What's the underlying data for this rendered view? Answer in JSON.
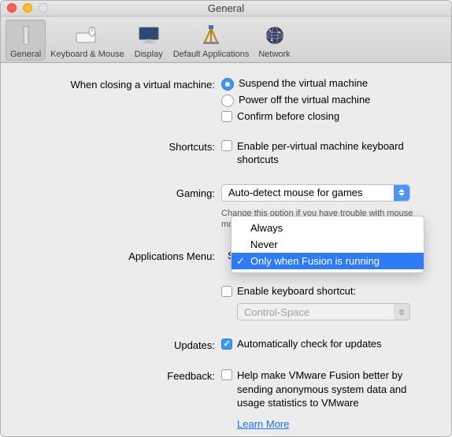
{
  "window": {
    "title": "General"
  },
  "toolbar": {
    "items": [
      {
        "label": "General"
      },
      {
        "label": "Keyboard & Mouse"
      },
      {
        "label": "Display"
      },
      {
        "label": "Default Applications"
      },
      {
        "label": "Network"
      }
    ]
  },
  "closing": {
    "label": "When closing a virtual machine:",
    "opt_suspend": "Suspend the virtual machine",
    "opt_poweroff": "Power off the virtual machine",
    "opt_confirm": "Confirm before closing"
  },
  "shortcuts": {
    "label": "Shortcuts:",
    "enable": "Enable per-virtual machine keyboard shortcuts"
  },
  "gaming": {
    "label": "Gaming:",
    "value": "Auto-detect mouse for games",
    "help": "Change this option if you have trouble with mouse motion in some applications."
  },
  "appmenu": {
    "label": "Applications Menu:",
    "hidden_value_char": "S",
    "options": [
      "Always",
      "Never",
      "Only when Fusion is running"
    ],
    "enable_shortcut": "Enable keyboard shortcut:",
    "shortcut_value": "Control-Space"
  },
  "updates": {
    "label": "Updates:",
    "auto": "Automatically check for updates"
  },
  "feedback": {
    "label": "Feedback:",
    "text": "Help make VMware Fusion better by sending anonymous system data and usage statistics to VMware",
    "learn_more": "Learn More"
  }
}
